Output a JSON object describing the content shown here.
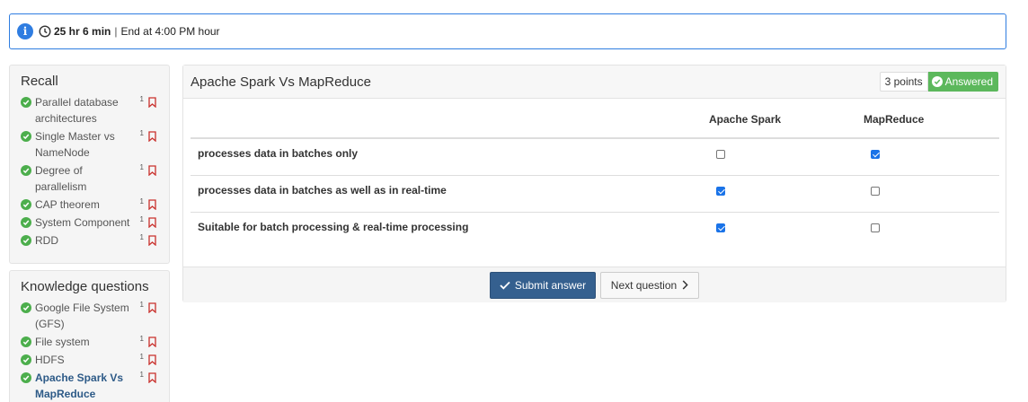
{
  "timer": {
    "info_icon": "info-icon",
    "clock_icon": "clock-icon",
    "remaining": "25 hr 6 min",
    "separator": "|",
    "end_text": "End at 4:00 PM hour"
  },
  "recall": {
    "title": "Recall",
    "items": [
      {
        "label": "Parallel database architectures",
        "count": "1",
        "status": "answered"
      },
      {
        "label": "Single Master vs NameNode",
        "count": "1",
        "status": "answered"
      },
      {
        "label": "Degree of parallelism",
        "count": "1",
        "status": "answered"
      },
      {
        "label": "CAP theorem",
        "count": "1",
        "status": "answered"
      },
      {
        "label": "System Component",
        "count": "1",
        "status": "answered"
      },
      {
        "label": "RDD",
        "count": "1",
        "status": "answered"
      }
    ]
  },
  "knowledge": {
    "title": "Knowledge questions",
    "items": [
      {
        "label": "Google File System (GFS)",
        "count": "1",
        "status": "answered"
      },
      {
        "label": "File system",
        "count": "1",
        "status": "answered"
      },
      {
        "label": "HDFS",
        "count": "1",
        "status": "answered"
      },
      {
        "label": "Apache Spark Vs MapReduce",
        "count": "1",
        "status": "answered",
        "active": true
      }
    ]
  },
  "question": {
    "title": "Apache Spark Vs MapReduce",
    "points": "3 points",
    "status_label": "Answered",
    "columns": [
      "",
      "Apache Spark",
      "MapReduce"
    ],
    "rows": [
      {
        "statement": "processes data in batches only",
        "apache_spark": false,
        "mapreduce": true
      },
      {
        "statement": "processes data in batches as well as in real-time",
        "apache_spark": true,
        "mapreduce": false
      },
      {
        "statement": "Suitable for batch processing & real-time processing",
        "apache_spark": true,
        "mapreduce": false
      }
    ],
    "submit_label": "Submit answer",
    "next_label": "Next question"
  },
  "colors": {
    "accent": "#2f7de1",
    "success": "#5cb85c",
    "primary_button": "#35608f",
    "bookmark": "#c9302c"
  }
}
